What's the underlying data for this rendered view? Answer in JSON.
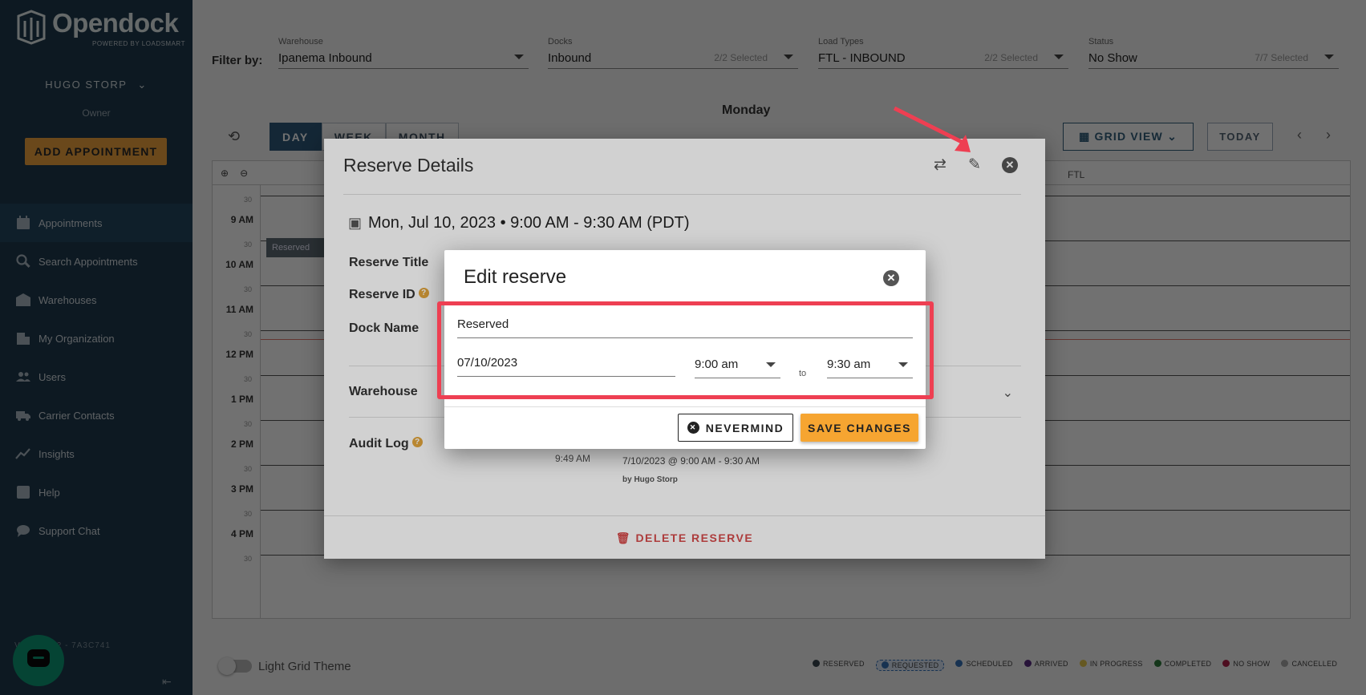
{
  "sidebar": {
    "brand": "Opendock",
    "brand_sub": "POWERED BY LOADSMART",
    "user_name": "HUGO STORP",
    "user_role": "Owner",
    "add_button": "ADD APPOINTMENT",
    "items": [
      {
        "label": "Appointments",
        "icon": "calendar-icon"
      },
      {
        "label": "Search Appointments",
        "icon": "search-icon"
      },
      {
        "label": "Warehouses",
        "icon": "warehouse-icon"
      },
      {
        "label": "My Organization",
        "icon": "building-icon"
      },
      {
        "label": "Users",
        "icon": "users-icon"
      },
      {
        "label": "Carrier Contacts",
        "icon": "truck-icon"
      },
      {
        "label": "Insights",
        "icon": "chart-icon"
      },
      {
        "label": "Help",
        "icon": "help-icon"
      },
      {
        "label": "Support Chat",
        "icon": "chat-icon"
      }
    ],
    "version": "VA V3.20.2 - 7A3C741"
  },
  "filters": {
    "label": "Filter by:",
    "warehouse": {
      "label": "Warehouse",
      "value": "Ipanema Inbound"
    },
    "docks": {
      "label": "Docks",
      "value": "Inbound",
      "count": "2/2 Selected"
    },
    "load_types": {
      "label": "Load Types",
      "value": "FTL - INBOUND",
      "count": "2/2 Selected"
    },
    "status": {
      "label": "Status",
      "value": "No Show",
      "count": "7/7 Selected"
    }
  },
  "calendar": {
    "day_name": "Monday",
    "tabs": [
      "DAY",
      "WEEK",
      "MONTH"
    ],
    "grid_view": "GRID VIEW",
    "today": "TODAY",
    "column_ftl": "FTL",
    "times": [
      "9 AM",
      "10 AM",
      "11 AM",
      "12 PM",
      "1 PM",
      "2 PM",
      "3 PM",
      "4 PM"
    ],
    "half": "30",
    "reserved_block": "Reserved",
    "light_grid": "Light Grid Theme",
    "legend": [
      "RESERVED",
      "REQUESTED",
      "SCHEDULED",
      "ARRIVED",
      "IN PROGRESS",
      "COMPLETED",
      "NO SHOW",
      "CANCELLED"
    ],
    "legend_colors": [
      "#3a4750",
      "#3672b8",
      "#3672b8",
      "#5a2d82",
      "#e6c84c",
      "#2f7d3b",
      "#b0224a",
      "#aaaaaa"
    ]
  },
  "details": {
    "title": "Reserve Details",
    "datetime": "Mon, Jul 10, 2023 • 9:00 AM - 9:30 AM (PDT)",
    "reserve_title_label": "Reserve Title",
    "reserve_id_label": "Reserve ID",
    "dock_name_label": "Dock Name",
    "warehouse_label": "Warehouse",
    "audit_log_label": "Audit Log",
    "audit_time": "9:49 AM",
    "audit_range": "7/10/2023 @ 9:00 AM - 9:30 AM",
    "audit_by": "by Hugo Storp",
    "delete": "DELETE RESERVE"
  },
  "edit": {
    "title": "Edit reserve",
    "reserve_title": "Reserved",
    "date": "07/10/2023",
    "start": "9:00 am",
    "to": "to",
    "end": "9:30 am",
    "nevermind": "NEVERMIND",
    "save": "SAVE CHANGES"
  },
  "accent": "#f0a340",
  "highlight_color": "#ee3f52"
}
